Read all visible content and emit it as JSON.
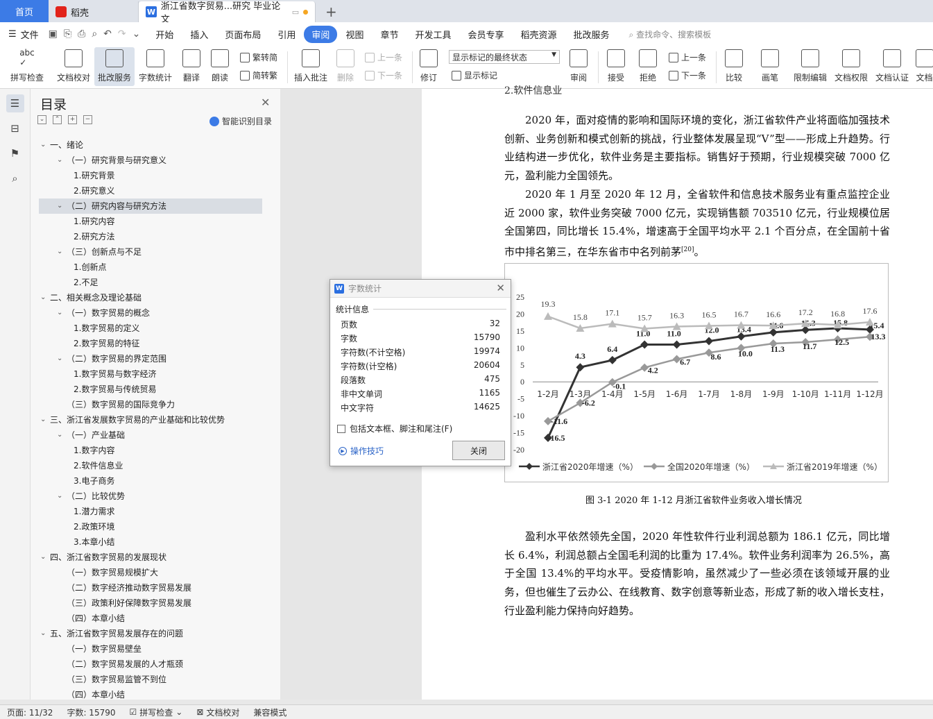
{
  "tabs": {
    "home": "首页",
    "daoke": "稻壳",
    "doc": "浙江省数字贸易...研究 毕业论文"
  },
  "menu": {
    "file": "文件",
    "items": [
      "开始",
      "插入",
      "页面布局",
      "引用",
      "审阅",
      "视图",
      "章节",
      "开发工具",
      "会员专享",
      "稻壳资源",
      "批改服务"
    ],
    "active": "审阅",
    "search": "查找命令、搜索模板"
  },
  "ribbon": {
    "spell": "拼写检查",
    "doccheck": "文档校对",
    "revise_service": "批改服务",
    "wordcount": "字数统计",
    "translate": "翻译",
    "read": "朗读",
    "trad2simp": "繁转简",
    "simp2trad": "简转繁",
    "insert_comment": "插入批注",
    "delete": "删除",
    "prev": "上一条",
    "next": "下一条",
    "track": "修订",
    "markup_state": "显示标记的最终状态",
    "show_markup": "显示标记",
    "review": "审阅",
    "accept": "接受",
    "reject": "拒绝",
    "prev2": "上一条",
    "next2": "下一条",
    "compare": "比较",
    "pen": "画笔",
    "restrict": "限制编辑",
    "permission": "文档权限",
    "certify": "文档认证",
    "more": "文档"
  },
  "toc": {
    "title": "目录",
    "smart": "智能识别目录",
    "items": [
      {
        "text": "一、绪论",
        "level": 0,
        "caret": "v"
      },
      {
        "text": "（一）研究背景与研究意义",
        "level": 1,
        "caret": "v"
      },
      {
        "text": "1.研究背景",
        "level": 2
      },
      {
        "text": "2.研究意义",
        "level": 2
      },
      {
        "text": "（二）研究内容与研究方法",
        "level": 1,
        "caret": "v",
        "hl": true
      },
      {
        "text": "1.研究内容",
        "level": 2
      },
      {
        "text": "2.研究方法",
        "level": 2
      },
      {
        "text": "（三）创新点与不足",
        "level": 1,
        "caret": "v"
      },
      {
        "text": "1.创新点",
        "level": 2
      },
      {
        "text": "2.不足",
        "level": 2
      },
      {
        "text": "二、相关概念及理论基础",
        "level": 0,
        "caret": "v"
      },
      {
        "text": "（一）数字贸易的概念",
        "level": 1,
        "caret": "v"
      },
      {
        "text": "1.数字贸易的定义",
        "level": 2
      },
      {
        "text": "2.数字贸易的特征",
        "level": 2
      },
      {
        "text": "（二）数字贸易的界定范围",
        "level": 1,
        "caret": "v"
      },
      {
        "text": "1.数字贸易与数字经济",
        "level": 2
      },
      {
        "text": "2.数字贸易与传统贸易",
        "level": 2
      },
      {
        "text": "（三）数字贸易的国际竞争力",
        "level": 1
      },
      {
        "text": "三、浙江省发展数字贸易的产业基础和比较优势",
        "level": 0,
        "caret": "v"
      },
      {
        "text": "（一）产业基础",
        "level": 1,
        "caret": "v"
      },
      {
        "text": "1.数字内容",
        "level": 2
      },
      {
        "text": "2.软件信息业",
        "level": 2
      },
      {
        "text": "3.电子商务",
        "level": 2
      },
      {
        "text": "（二）比较优势",
        "level": 1,
        "caret": "v"
      },
      {
        "text": "1.潜力需求",
        "level": 2
      },
      {
        "text": "2.政策环境",
        "level": 2
      },
      {
        "text": "3.本章小结",
        "level": 2
      },
      {
        "text": "四、浙江省数字贸易的发展现状",
        "level": 0,
        "caret": "v"
      },
      {
        "text": "（一）数字贸易规模扩大",
        "level": 1
      },
      {
        "text": "（二）数字经济推动数字贸易发展",
        "level": 1
      },
      {
        "text": "（三）政策利好保障数字贸易发展",
        "level": 1
      },
      {
        "text": "（四）本章小结",
        "level": 1
      },
      {
        "text": "五、浙江省数字贸易发展存在的问题",
        "level": 0,
        "caret": "v"
      },
      {
        "text": "（一）数字贸易壁垒",
        "level": 1
      },
      {
        "text": "（二）数字贸易发展的人才瓶颈",
        "level": 1
      },
      {
        "text": "（三）数字贸易监管不到位",
        "level": 1
      },
      {
        "text": "（四）本章小结",
        "level": 1
      }
    ]
  },
  "doc": {
    "head_cut": "2.软件信息业",
    "p1": "2020 年，面对疫情的影响和国际环境的变化，浙江省软件产业将面临加强技术创新、业务创新和模式创新的挑战，行业整体发展呈现“V”型——形成上升趋势。行业结构进一步优化，软件业务是主要指标。销售好于预期，行业规模突破 7000 亿元，盈利能力全国领先。",
    "p2": "2020 年 1 月至 2020 年 12 月，全省软件和信息技术服务业有重点监控企业近 2000 家，软件业务突破 7000 亿元，实现销售额 703510 亿元，行业规模位居全国第四，同比增长 15.4%，增速高于全国平均水平 2.1 个百分点，在全国前十省市中排名第三，在华东省市中名列前茅",
    "cite": "[20]",
    "p2_end": "。",
    "caption": "图 3-1 2020 年 1-12 月浙江省软件业务收入增长情况",
    "p3": "盈利水平依然领先全国，2020 年性软件行业利润总额为 186.1 亿元，同比增长 6.4%，利润总额占全国毛利润的比重为 17.4%。软件业务利润率为 26.5%，高于全国 13.4%的平均水平。受疫情影响，虽然减少了一些必须在该领域开展的业务，但也催生了云办公、在线教育、数字创意等新业态，形成了新的收入增长支柱，行业盈利能力保持向好趋势。"
  },
  "dialog": {
    "title": "字数统计",
    "section": "统计信息",
    "rows": [
      {
        "label": "页数",
        "value": "32"
      },
      {
        "label": "字数",
        "value": "15790"
      },
      {
        "label": "字符数(不计空格)",
        "value": "19974"
      },
      {
        "label": "字符数(计空格)",
        "value": "20604"
      },
      {
        "label": "段落数",
        "value": "475"
      },
      {
        "label": "非中文单词",
        "value": "1165"
      },
      {
        "label": "中文字符",
        "value": "14625"
      }
    ],
    "checkbox": "包括文本框、脚注和尾注(F)",
    "tips": "操作技巧",
    "close": "关闭"
  },
  "status": {
    "page": "页面: 11/32",
    "words": "字数: 15790",
    "spell": "拼写检查",
    "doccheck": "文档校对",
    "compat": "兼容模式"
  },
  "chart_data": {
    "type": "line",
    "categories": [
      "1-2月",
      "1-3月",
      "1-4月",
      "1-5月",
      "1-6月",
      "1-7月",
      "1-8月",
      "1-9月",
      "1-10月",
      "1-11月",
      "1-12月"
    ],
    "ylim": [
      -20,
      25
    ],
    "yticks": [
      25,
      20,
      15,
      10,
      5,
      0,
      -5,
      -10,
      -15,
      -20
    ],
    "series": [
      {
        "name": "浙江省2020年增速（%）",
        "values": [
          -16.5,
          4.3,
          6.4,
          11.0,
          11.0,
          12.0,
          13.4,
          14.6,
          15.3,
          15.8,
          15.4
        ],
        "color": "#333333",
        "marker": "diamond"
      },
      {
        "name": "全国2020年增速（%）",
        "values": [
          -11.6,
          -6.2,
          -0.1,
          4.2,
          6.7,
          8.6,
          10.0,
          11.3,
          11.7,
          12.5,
          13.3
        ],
        "color": "#999999",
        "marker": "diamond"
      },
      {
        "name": "浙江省2019年增速（%）",
        "values": [
          19.3,
          15.8,
          17.1,
          15.7,
          16.3,
          16.5,
          16.7,
          16.6,
          17.2,
          16.8,
          17.6
        ],
        "color": "#bbbbbb",
        "marker": "triangle"
      }
    ],
    "legend": "bottom"
  }
}
